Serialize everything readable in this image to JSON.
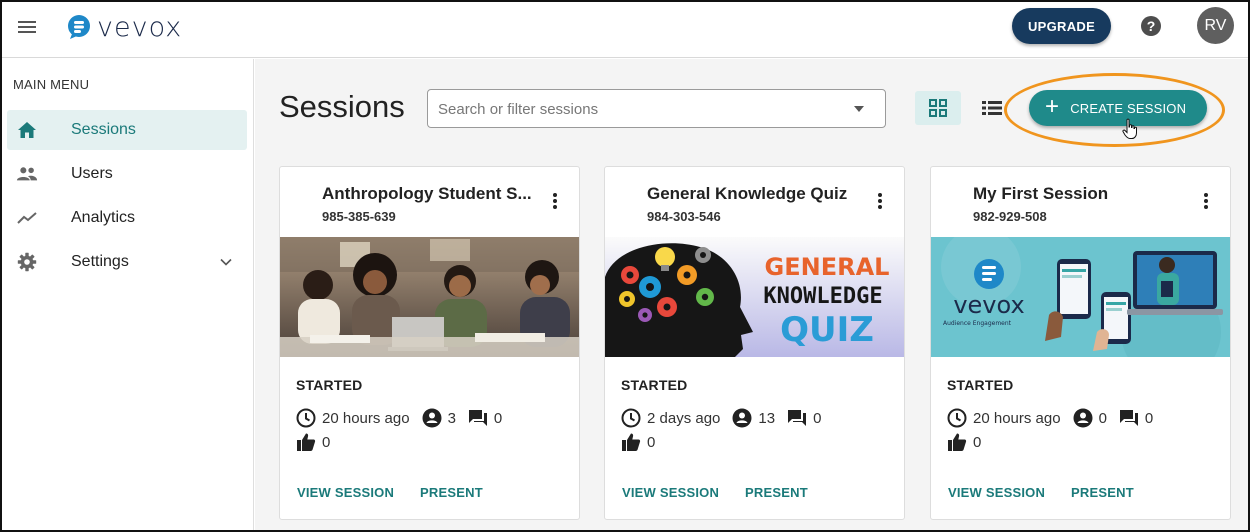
{
  "header": {
    "logo_text": "vevox",
    "upgrade_label": "UPGRADE",
    "help_label": "?",
    "avatar_initials": "RV",
    "brand_color": "#173a5e"
  },
  "sidebar": {
    "menu_title": "MAIN MENU",
    "items": [
      {
        "label": "Sessions",
        "icon": "home-icon",
        "active": true
      },
      {
        "label": "Users",
        "icon": "users-icon",
        "active": false
      },
      {
        "label": "Analytics",
        "icon": "analytics-icon",
        "active": false
      },
      {
        "label": "Settings",
        "icon": "gear-icon",
        "active": false,
        "expandable": true
      }
    ]
  },
  "main": {
    "title": "Sessions",
    "search": {
      "placeholder": "Search or filter sessions",
      "value": ""
    },
    "view_mode": "grid",
    "create_label": "CREATE SESSION",
    "accent_color": "#1f8a8a",
    "highlight_color": "#f0951e"
  },
  "sessions": [
    {
      "title": "Anthropology Student S...",
      "code": "985-385-639",
      "status": "STARTED",
      "time": "20 hours ago",
      "participants": "3",
      "comments": "0",
      "likes": "0",
      "image": "students-studying-photo",
      "view_label": "VIEW SESSION",
      "present_label": "PRESENT"
    },
    {
      "title": "General Knowledge Quiz",
      "code": "984-303-546",
      "status": "STARTED",
      "time": "2 days ago",
      "participants": "13",
      "comments": "0",
      "likes": "0",
      "image": "general-knowledge-quiz-graphic",
      "image_text": [
        "GENERAL",
        "KNOWLEDGE",
        "QUIZ"
      ],
      "view_label": "VIEW SESSION",
      "present_label": "PRESENT"
    },
    {
      "title": "My First Session",
      "code": "982-929-508",
      "status": "STARTED",
      "time": "20 hours ago",
      "participants": "0",
      "comments": "0",
      "likes": "0",
      "image": "vevox-audience-engagement-graphic",
      "image_text": [
        "vevox",
        "Audience Engagement"
      ],
      "view_label": "VIEW SESSION",
      "present_label": "PRESENT"
    }
  ]
}
